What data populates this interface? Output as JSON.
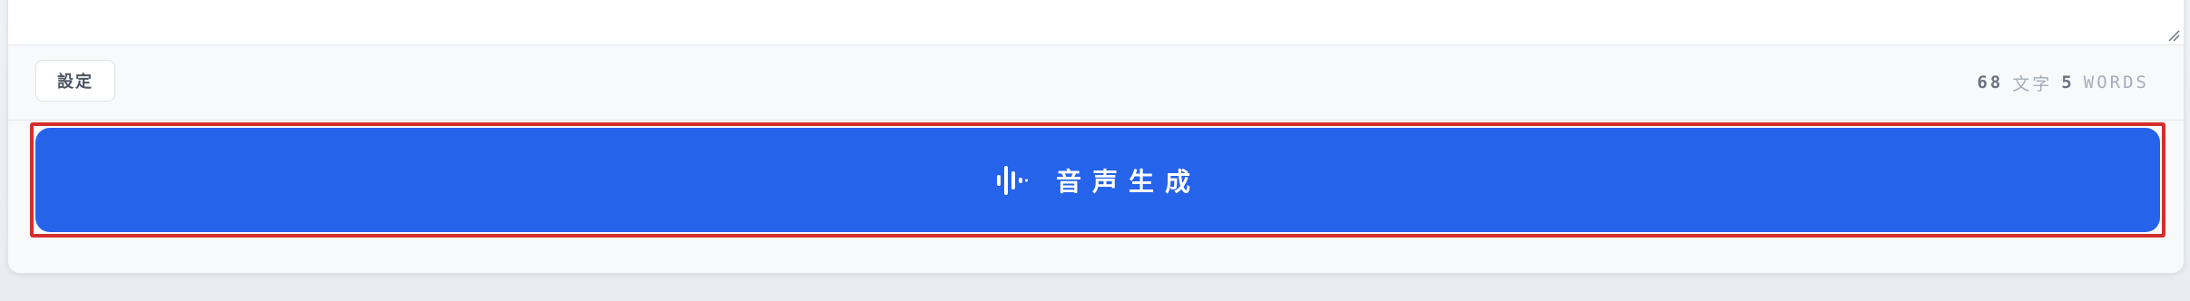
{
  "toolbar": {
    "settings_label": "設定",
    "counter": {
      "char_count": "68",
      "char_unit": "文字",
      "word_count": "5",
      "word_unit": "WORDS"
    }
  },
  "action": {
    "generate_label": "音声生成",
    "icon": "audio-waveform-icon",
    "button_color": "#2563eb",
    "highlight_color": "#d32f2f"
  }
}
